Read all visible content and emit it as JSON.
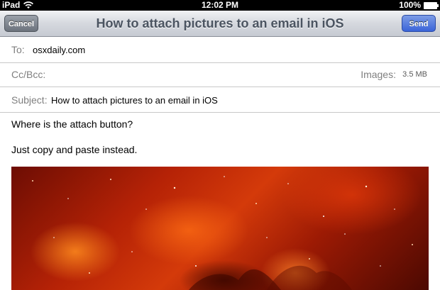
{
  "status_bar": {
    "device": "iPad",
    "time": "12:02 PM",
    "battery": "100%"
  },
  "nav": {
    "cancel_label": "Cancel",
    "title": "How to attach pictures to an email in iOS",
    "send_label": "Send"
  },
  "fields": {
    "to_label": "To:",
    "to_value": "osxdaily.com",
    "cc_label": "Cc/Bcc:",
    "images_label": "Images:",
    "images_size": "3.5 MB",
    "subject_label": "Subject:",
    "subject_value": "How to attach pictures to an email in iOS"
  },
  "body": {
    "line1": "Where is the attach button?",
    "line2": "Just copy and paste instead."
  },
  "colors": {
    "send_button": "#3a64d8",
    "cancel_button": "#6c737d",
    "label_gray": "#7f7f7f"
  }
}
